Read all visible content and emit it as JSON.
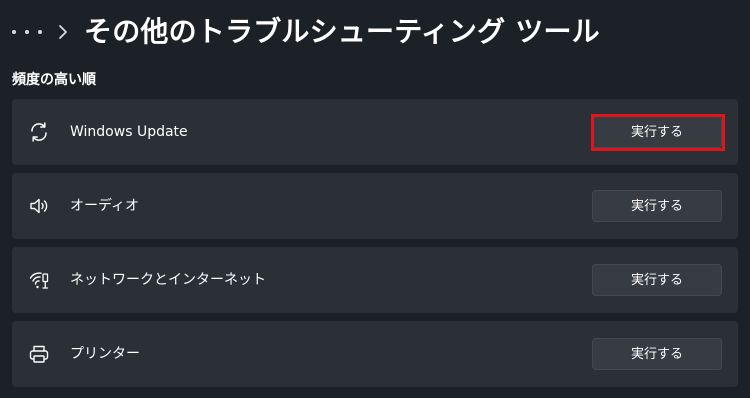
{
  "header": {
    "title": "その他のトラブルシューティング ツール",
    "more_icon": "more-horizontal-icon",
    "separator_icon": "chevron-right-icon"
  },
  "section": {
    "label": "頻度の高い順"
  },
  "items": [
    {
      "label": "Windows Update",
      "icon": "sync-icon",
      "button_label": "実行する",
      "highlighted": true
    },
    {
      "label": "オーディオ",
      "icon": "speaker-icon",
      "button_label": "実行する",
      "highlighted": false
    },
    {
      "label": "ネットワークとインターネット",
      "icon": "network-icon",
      "button_label": "実行する",
      "highlighted": false
    },
    {
      "label": "プリンター",
      "icon": "printer-icon",
      "button_label": "実行する",
      "highlighted": false
    }
  ],
  "colors": {
    "background": "#1c2027",
    "card": "#2b2f36",
    "button": "#373b42",
    "highlight": "#e0141b"
  }
}
